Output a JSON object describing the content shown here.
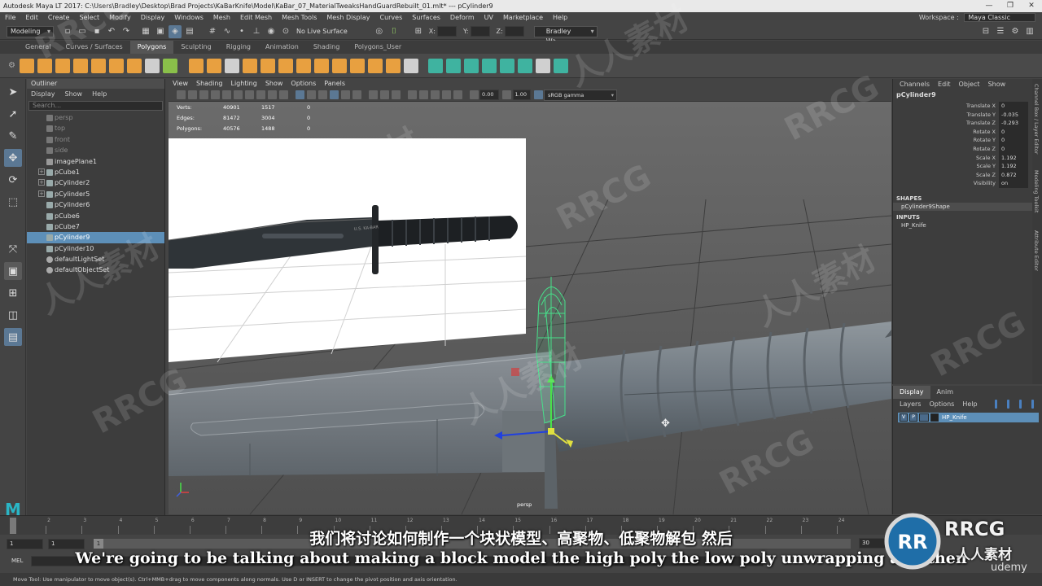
{
  "window": {
    "title": "Autodesk Maya LT 2017: C:\\Users\\Bradley\\Desktop\\Brad Projects\\KaBarKnife\\Model\\KaBar_07_MaterialTweaksHandGuardRebuilt_01.mlt*  ---  pCylinder9",
    "minimize": "—",
    "restore": "❐",
    "close": "✕"
  },
  "menubar": {
    "items": [
      "File",
      "Edit",
      "Create",
      "Select",
      "Modify",
      "Display",
      "Windows",
      "Mesh",
      "Edit Mesh",
      "Mesh Tools",
      "Mesh Display",
      "Curves",
      "Surfaces",
      "Deform",
      "UV",
      "Marketplace",
      "Help"
    ],
    "workspace_label": "Workspace :",
    "workspace_value": "Maya Classic"
  },
  "statusline": {
    "mode": "Modeling",
    "live_surface": "No Live Surface",
    "x_label": "X:",
    "y_label": "Y:",
    "z_label": "Z:",
    "user": "Bradley Wa..."
  },
  "shelf": {
    "tabs": [
      "General",
      "Curves / Surfaces",
      "Polygons",
      "Sculpting",
      "Rigging",
      "Animation",
      "Shading",
      "Polygons_User"
    ],
    "selected_tab": "Polygons"
  },
  "outliner": {
    "title": "Outliner",
    "menus": [
      "Display",
      "Show",
      "Help"
    ],
    "search_placeholder": "Search...",
    "items": [
      {
        "label": "persp",
        "type": "camera",
        "expand": ""
      },
      {
        "label": "top",
        "type": "camera",
        "expand": ""
      },
      {
        "label": "front",
        "type": "camera",
        "expand": ""
      },
      {
        "label": "side",
        "type": "camera",
        "expand": ""
      },
      {
        "label": "imagePlane1",
        "type": "image",
        "expand": ""
      },
      {
        "label": "pCube1",
        "type": "mesh",
        "expand": "+"
      },
      {
        "label": "pCylinder2",
        "type": "mesh",
        "expand": "+"
      },
      {
        "label": "pCylinder5",
        "type": "mesh",
        "expand": "+"
      },
      {
        "label": "pCylinder6",
        "type": "mesh",
        "expand": ""
      },
      {
        "label": "pCube6",
        "type": "mesh",
        "expand": ""
      },
      {
        "label": "pCube7",
        "type": "mesh",
        "expand": ""
      },
      {
        "label": "pCylinder9",
        "type": "mesh",
        "expand": "",
        "selected": true
      },
      {
        "label": "pCylinder10",
        "type": "mesh",
        "expand": ""
      },
      {
        "label": "defaultLightSet",
        "type": "set",
        "expand": ""
      },
      {
        "label": "defaultObjectSet",
        "type": "set",
        "expand": ""
      }
    ]
  },
  "viewport": {
    "menus": [
      "View",
      "Shading",
      "Lighting",
      "Show",
      "Options",
      "Panels"
    ],
    "exposure": "0.00",
    "gamma": "1.00",
    "color_space": "sRGB gamma",
    "camera_label": "persp",
    "hud": [
      {
        "label": "Verts:",
        "a": "40901",
        "b": "1517",
        "c": "0"
      },
      {
        "label": "Edges:",
        "a": "81472",
        "b": "3004",
        "c": "0"
      },
      {
        "label": "Polygons:",
        "a": "40576",
        "b": "1488",
        "c": "0"
      }
    ],
    "ref_markings": "U.S. KA-BAR"
  },
  "channelbox": {
    "menus": [
      "Channels",
      "Edit",
      "Object",
      "Show"
    ],
    "object": "pCylinder9",
    "attributes": [
      {
        "name": "Translate X",
        "value": "0"
      },
      {
        "name": "Translate Y",
        "value": "-0.035"
      },
      {
        "name": "Translate Z",
        "value": "-0.293"
      },
      {
        "name": "Rotate X",
        "value": "0"
      },
      {
        "name": "Rotate Y",
        "value": "0"
      },
      {
        "name": "Rotate Z",
        "value": "0"
      },
      {
        "name": "Scale X",
        "value": "1.192"
      },
      {
        "name": "Scale Y",
        "value": "1.192"
      },
      {
        "name": "Scale Z",
        "value": "0.872"
      },
      {
        "name": "Visibility",
        "value": "on"
      }
    ],
    "shapes_label": "SHAPES",
    "shape": "pCylinder9Shape",
    "inputs_label": "INPUTS",
    "input": "HP_Knife",
    "side_tabs": [
      "Channel Box / Layer Editor",
      "Modeling Toolkit",
      "Attribute Editor"
    ]
  },
  "layereditor": {
    "tabs": [
      "Display",
      "Anim"
    ],
    "selected_tab": "Display",
    "menus": [
      "Layers",
      "Options",
      "Help"
    ],
    "layer": {
      "v": "V",
      "p": "P",
      "name": "HP_Knife"
    }
  },
  "timeslider": {
    "ticks": [
      "1",
      "2",
      "3",
      "4",
      "5",
      "6",
      "7",
      "8",
      "9",
      "10",
      "11",
      "12",
      "13",
      "14",
      "15",
      "16",
      "17",
      "18",
      "19",
      "20",
      "21",
      "22",
      "23",
      "24"
    ],
    "current": "1"
  },
  "rangeslider": {
    "start": "1",
    "start2": "1",
    "range_start": "1",
    "end": "30"
  },
  "cmdline": {
    "label": "MEL"
  },
  "helpline": {
    "text": "Move Tool: Use manipulator to move object(s). Ctrl+MMB+drag to move components along normals. Use D or INSERT to change the pivot position and axis orientation."
  },
  "subtitles": {
    "cn": "我们将讨论如何制作一个块状模型、高聚物、低聚物解包 然后",
    "en": "We're going to be talking about making a block model the high poly the low poly unwrapping and then"
  },
  "watermarks": {
    "rrcg": "RRCG",
    "cn": "人人素材",
    "udemy": "udemy",
    "logo_text": "RRCG",
    "logo_cn": "人人素材"
  }
}
